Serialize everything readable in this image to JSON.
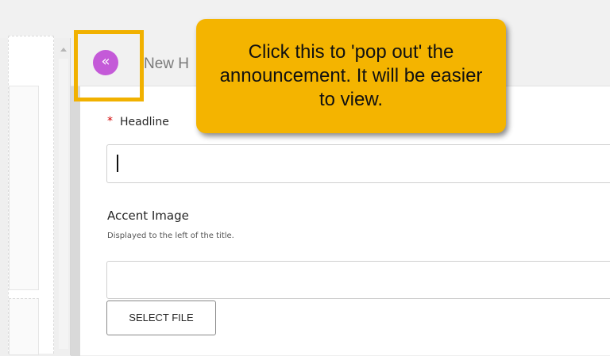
{
  "dialog": {
    "title": "New H",
    "popout_icon": "chevron-double-left-icon",
    "popout_glyph": "«"
  },
  "form": {
    "headline": {
      "required_mark": "*",
      "label": "Headline",
      "value": ""
    },
    "accent_image": {
      "label": "Accent Image",
      "help": "Displayed to the left of the title.",
      "value": ""
    },
    "select_file_label": "SELECT FILE"
  },
  "callout": {
    "text": "Click this to 'pop out' the announcement. It will be easier to view."
  },
  "colors": {
    "highlight": "#f1b100",
    "callout": "#f4b400",
    "popout_button": "#c45ad8",
    "required": "#d20000"
  }
}
